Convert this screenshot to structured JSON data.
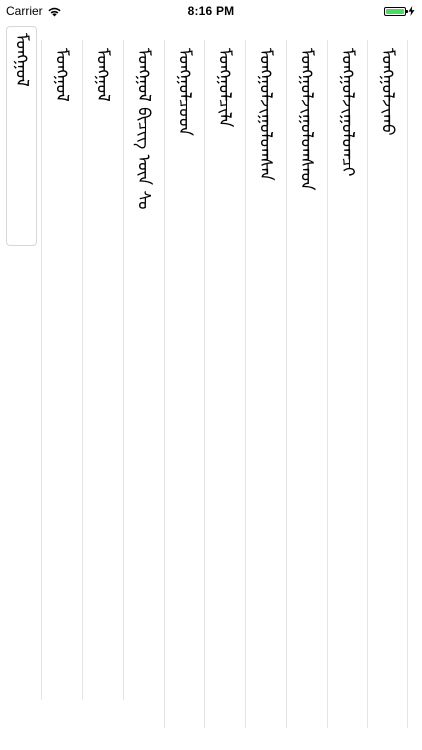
{
  "status_bar": {
    "carrier": "Carrier",
    "time": "8:16 PM",
    "battery_color": "#4cd964"
  },
  "columns": [
    {
      "text": "ᠮᠣᠩᠭᠣᠯ",
      "selected": true
    },
    {
      "text": "ᠮᠣᠩᠭᠣᠯ"
    },
    {
      "text": "ᠮᠣᠩᠭᠣᠯ"
    },
    {
      "text": "ᠮᠣᠩᠭᠣᠯ ᠪᠢᠴᠢᠭ ᠦᠨ ᠰᠤ"
    },
    {
      "text": "ᠮᠣᠩᠭᠣᠯᠴᠤᠳ"
    },
    {
      "text": "ᠮᠣᠩᠭᠣᠯᠴᠢᠯᠠ"
    },
    {
      "text": "ᠮᠣᠩᠭᠣᠯᠵᠢᠭᠤᠯᠤᠭᠰᠠᠨ"
    },
    {
      "text": "ᠮᠣᠩᠭᠣᠯᠵᠢᠭᠤᠯᠤᠭᠰᠠᠳ"
    },
    {
      "text": "ᠮᠣᠩᠭᠣᠯᠵᠢᠭᠤᠯᠤᠭᠴᠢ"
    },
    {
      "text": "ᠮᠣᠩᠭᠣᠯᠵᠢᠬᠤ"
    }
  ]
}
